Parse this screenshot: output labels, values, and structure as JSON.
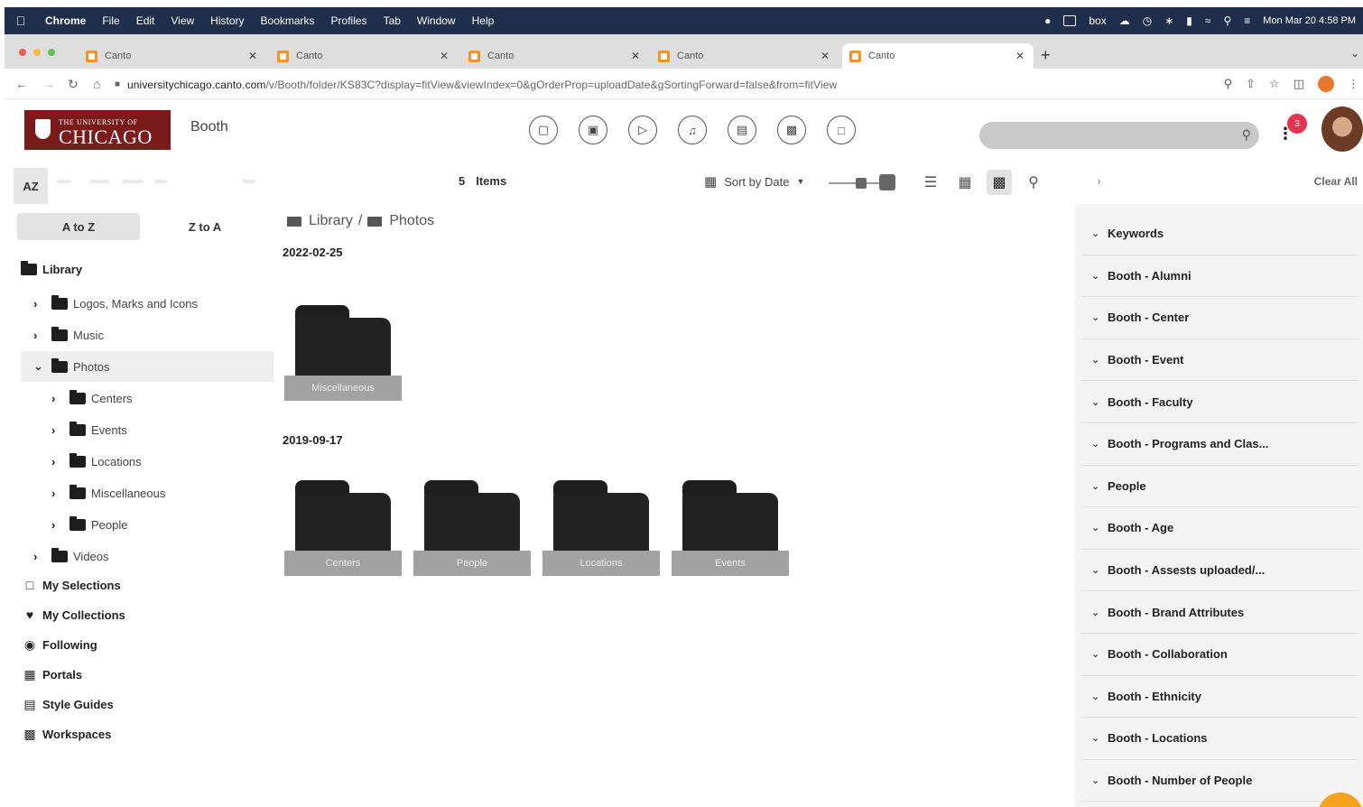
{
  "menubar": {
    "app": "Chrome",
    "items": [
      "File",
      "Edit",
      "View",
      "History",
      "Bookmarks",
      "Profiles",
      "Tab",
      "Window",
      "Help"
    ],
    "box": "box",
    "clock": "Mon Mar 20  4:58 PM"
  },
  "tabs": [
    {
      "title": "Canto"
    },
    {
      "title": "Canto"
    },
    {
      "title": "Canto"
    },
    {
      "title": "Canto"
    },
    {
      "title": "Canto"
    }
  ],
  "browser": {
    "url_host": "universitychicago.canto.com",
    "url_path": "/v/Booth/folder/KS83C?display=fitView&viewIndex=0&gOrderProp=uploadDate&gSortingForward=false&from=fitView"
  },
  "header": {
    "logo_line1": "THE UNIVERSITY OF",
    "logo_line2": "CHICAGO",
    "portal": "Booth",
    "notification_count": "3"
  },
  "toolbar": {
    "az": "AZ",
    "item_count": "5",
    "items_label": "Items",
    "sort_label": "Sort by Date",
    "clear_all": "Clear All"
  },
  "sidebar": {
    "sort_a_z": "A to Z",
    "sort_z_a": "Z to A",
    "library": "Library",
    "tree": [
      {
        "label": "Logos, Marks and Icons"
      },
      {
        "label": "Music"
      },
      {
        "label": "Photos"
      },
      {
        "label": "Centers"
      },
      {
        "label": "Events"
      },
      {
        "label": "Locations"
      },
      {
        "label": "Miscellaneous"
      },
      {
        "label": "People"
      },
      {
        "label": "Videos"
      }
    ],
    "links": [
      {
        "label": "My Selections"
      },
      {
        "label": "My Collections"
      },
      {
        "label": "Following"
      },
      {
        "label": "Portals"
      },
      {
        "label": "Style Guides"
      },
      {
        "label": "Workspaces"
      }
    ]
  },
  "main": {
    "breadcrumb": [
      "Library",
      "Photos"
    ],
    "groups": [
      {
        "date": "2022-02-25",
        "folders": [
          "Miscellaneous"
        ]
      },
      {
        "date": "2019-09-17",
        "folders": [
          "Centers",
          "People",
          "Locations",
          "Events"
        ]
      }
    ]
  },
  "filters": [
    "Keywords",
    "Booth - Alumni",
    "Booth - Center",
    "Booth - Event",
    "Booth - Faculty",
    "Booth - Programs and Clas...",
    "People",
    "Booth - Age",
    "Booth - Assests uploaded/...",
    "Booth - Brand Attributes",
    "Booth - Collaboration",
    "Booth - Ethnicity",
    "Booth - Locations",
    "Booth - Number of People"
  ]
}
